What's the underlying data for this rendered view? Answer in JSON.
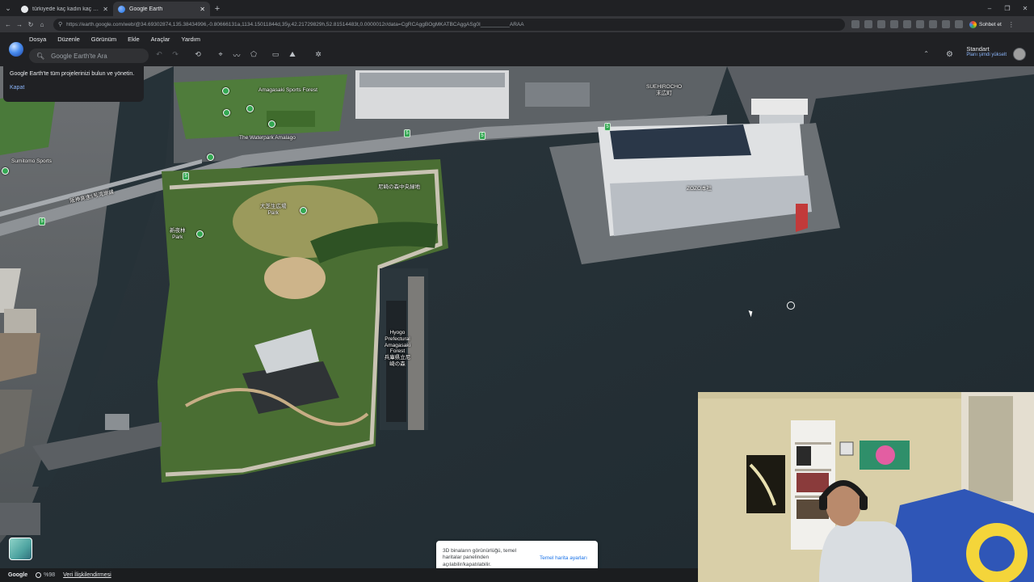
{
  "browser": {
    "tabs": [
      {
        "title": "türkiyede kaç kadın kaç erkek var",
        "active": false
      },
      {
        "title": "Google Earth",
        "active": true
      }
    ],
    "url": "https://earth.google.com/web/@34.69302874,135.38434996,-0.80666131a,1134.15011844d,35y,42.21729829h,52.81514483t,0.0000012r/data=CgRCAggBOgMKATBCAggASg0I__________ARAA",
    "chat_label": "Sohbet et"
  },
  "menu": {
    "items": [
      "Dosya",
      "Düzenle",
      "Görünüm",
      "Ekle",
      "Araçlar",
      "Yardım"
    ]
  },
  "toolbar": {
    "search_placeholder": "Google Earth'te Ara"
  },
  "account": {
    "plan": "Standart",
    "upgrade": "Planı şimdi yükselt"
  },
  "tip": {
    "text": "Google Earth'te tüm projelerinizi bulun ve yönetin.",
    "close": "Kapat"
  },
  "map_labels": {
    "suehirocho": "SUEHIROCHO",
    "suehirocho_jp": "末広町",
    "amagasaki_sports_forest": "Amagasaki Sports Forest",
    "waterpark": "The Waterpark Amalago",
    "sports": "Sumitomo Sports",
    "forest_jp": "尼崎の森中央緑地",
    "highway": "阪神高速5号湾岸線",
    "field": "大芝生広場",
    "park": "Park",
    "forest2": "新夜林",
    "warehouse": "ZOZO本社",
    "hyogo": "Hyogo Prefectural Amagasaki Forest",
    "hyogo_jp": "兵庫県立尼崎の森",
    "route": "5"
  },
  "toast": {
    "message": "3D binaların görünürlüğü, temel haritalar panelinden açılabilir/kapatılabilir.",
    "action": "Temel harita ayarları"
  },
  "status": {
    "brand": "Google",
    "progress": "%98",
    "data_link": "Veri İlişkilendirmesi"
  },
  "colors": {
    "water": "#263238",
    "park_green": "#3f6b2c",
    "pin_green": "#34a853",
    "link_blue": "#8ab4f8"
  }
}
